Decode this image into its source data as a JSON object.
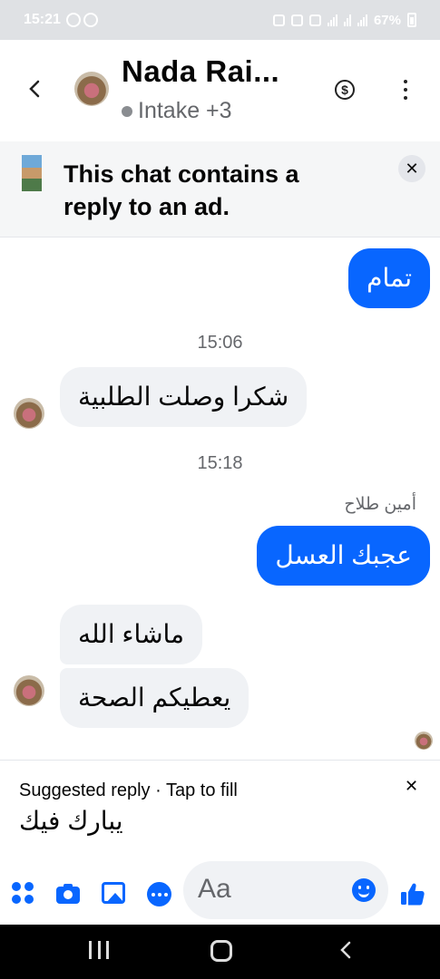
{
  "status_bar": {
    "time": "15:21",
    "battery": "67%"
  },
  "header": {
    "contact_name": "Nada Rai...",
    "contact_sub": "Intake +3"
  },
  "ad_banner": {
    "text": "This chat contains a reply to an ad."
  },
  "messages": [
    {
      "id": "m1",
      "direction": "out",
      "text": "تمام"
    },
    {
      "id": "ts1",
      "timestamp": "15:06"
    },
    {
      "id": "m2",
      "direction": "in",
      "text": "شكرا وصلت الطلبية"
    },
    {
      "id": "ts2",
      "timestamp": "15:18"
    },
    {
      "id": "n1",
      "sender": "أمين طلاح"
    },
    {
      "id": "m3",
      "direction": "out",
      "text": "عجبك العسل"
    },
    {
      "id": "m4",
      "direction": "in",
      "text": "ماشاء الله"
    },
    {
      "id": "m5",
      "direction": "in",
      "text": "يعطيكم الصحة"
    }
  ],
  "suggested_reply": {
    "label": "Suggested reply · Tap to fill",
    "text": "يبارك فيك"
  },
  "composer": {
    "placeholder": "Aa"
  },
  "colors": {
    "accent": "#0866ff",
    "incoming_bubble": "#f0f2f5",
    "status_bar": "#dfe1e4"
  }
}
